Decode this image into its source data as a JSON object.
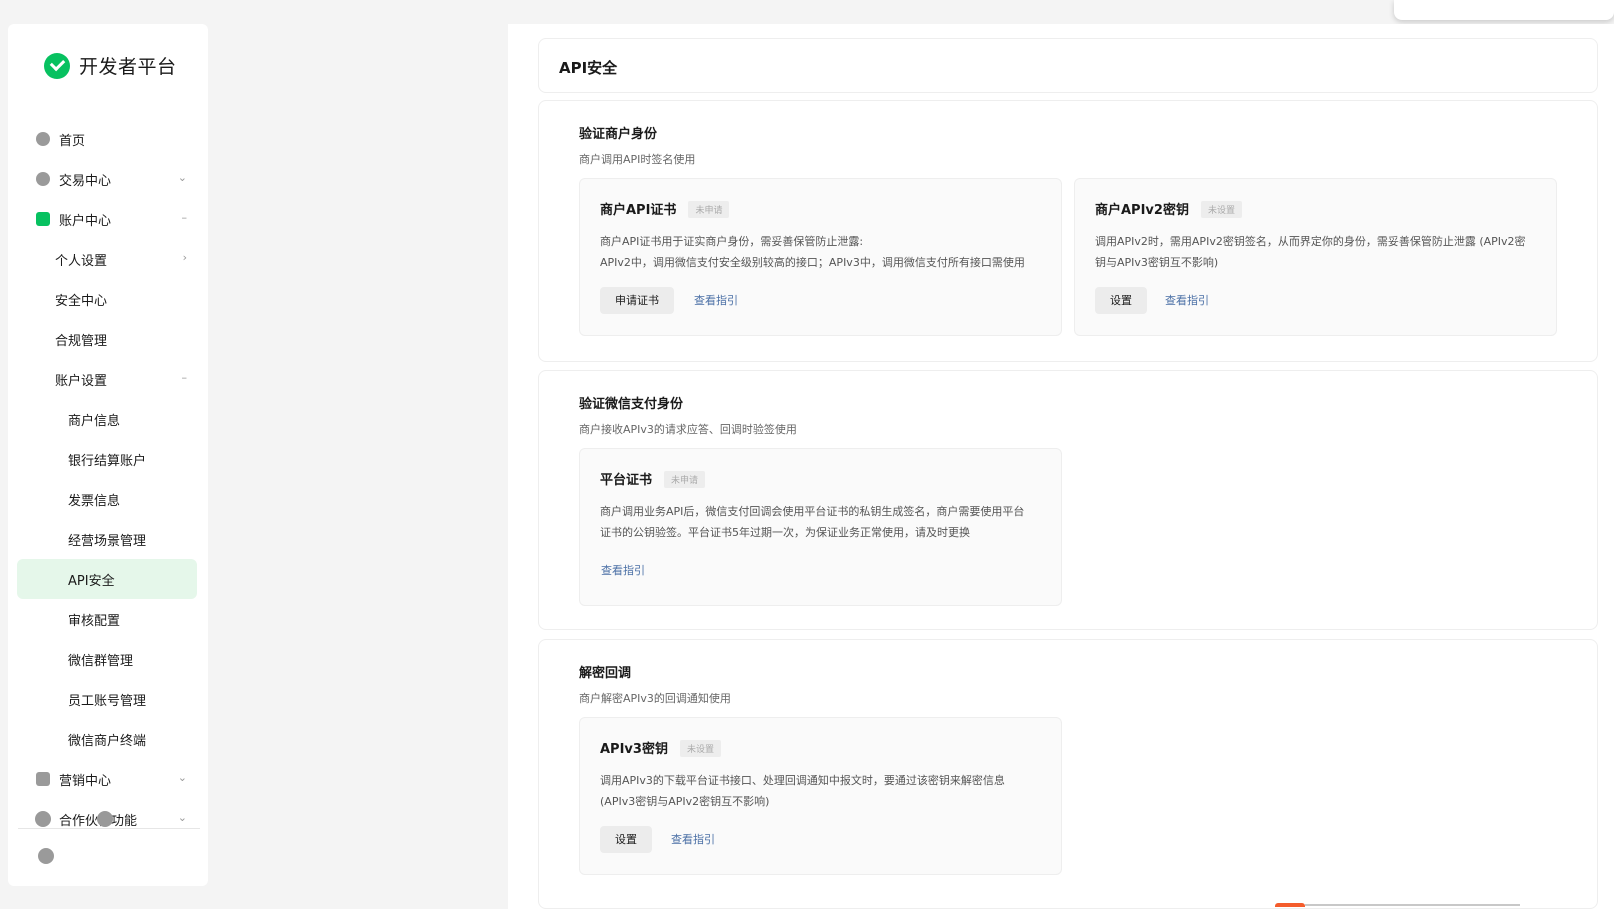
{
  "app": {
    "title": "开发者平台"
  },
  "sidebar": {
    "items": [
      {
        "label": "首页",
        "level": 1,
        "icon": "home-icon"
      },
      {
        "label": "交易中心",
        "level": 1,
        "icon": "transaction-icon",
        "caret": "⌄"
      },
      {
        "label": "账户中心",
        "level": 1,
        "icon": "account-icon",
        "caret": "–"
      },
      {
        "label": "个人设置",
        "level": 2,
        "caret": "›"
      },
      {
        "label": "安全中心",
        "level": 2
      },
      {
        "label": "合规管理",
        "level": 2
      },
      {
        "label": "账户设置",
        "level": 2,
        "caret": "–"
      },
      {
        "label": "商户信息",
        "level": 3
      },
      {
        "label": "银行结算账户",
        "level": 3
      },
      {
        "label": "发票信息",
        "level": 3
      },
      {
        "label": "经营场景管理",
        "level": 3
      },
      {
        "label": "API安全",
        "level": 3,
        "active": true
      },
      {
        "label": "审核配置",
        "level": 3
      },
      {
        "label": "微信群管理",
        "level": 3
      },
      {
        "label": "员工账号管理",
        "level": 3
      },
      {
        "label": "微信商户终端",
        "level": 3
      },
      {
        "label": "营销中心",
        "level": 1,
        "icon": "marketing-icon",
        "caret": "⌄"
      },
      {
        "label": "合作伙伴功能",
        "level": 1,
        "icon": "partner-icon",
        "caret": "⌄"
      }
    ]
  },
  "header": {
    "title": "API安全"
  },
  "sections": [
    {
      "title": "验证商户身份",
      "desc": "商户调用API时签名使用",
      "cards": [
        {
          "title": "商户API证书",
          "badge": "未申请",
          "desc_lines": [
            "商户API证书用于证实商户身份，需妥善保管防止泄露:",
            "APIv2中，调用微信支付安全级别较高的接口；APIv3中，调用微信支付所有接口需使用"
          ],
          "button": "申请证书",
          "link": "查看指引"
        },
        {
          "title": "商户APIv2密钥",
          "badge": "未设置",
          "desc_lines": [
            "调用APIv2时，需用APIv2密钥签名，从而界定你的身份，需妥善保管防止泄露 (APIv2密",
            "钥与APIv3密钥互不影响)"
          ],
          "button": "设置",
          "link": "查看指引"
        }
      ]
    },
    {
      "title": "验证微信支付身份",
      "desc": "商户接收APIv3的请求应答、回调时验签使用",
      "cards": [
        {
          "title": "平台证书",
          "badge": "未申请",
          "desc_lines": [
            "商户调用业务API后，微信支付回调会使用平台证书的私钥生成签名，商户需要使用平台",
            "证书的公钥验签。平台证书5年过期一次，为保证业务正常使用，请及时更换"
          ],
          "link": "查看指引"
        }
      ]
    },
    {
      "title": "解密回调",
      "desc": "商户解密APIv3的回调通知使用",
      "cards": [
        {
          "title": "APIv3密钥",
          "badge": "未设置",
          "desc_lines": [
            "调用APIv3的下载平台证书接口、处理回调通知中报文时，要通过该密钥来解密信息",
            "(APIv3密钥与APIv2密钥互不影响)"
          ],
          "button": "设置",
          "link": "查看指引"
        }
      ]
    }
  ],
  "colors": {
    "brand": "#07c160",
    "active_bg": "#e5f7ea",
    "link": "#4a6fa5"
  }
}
